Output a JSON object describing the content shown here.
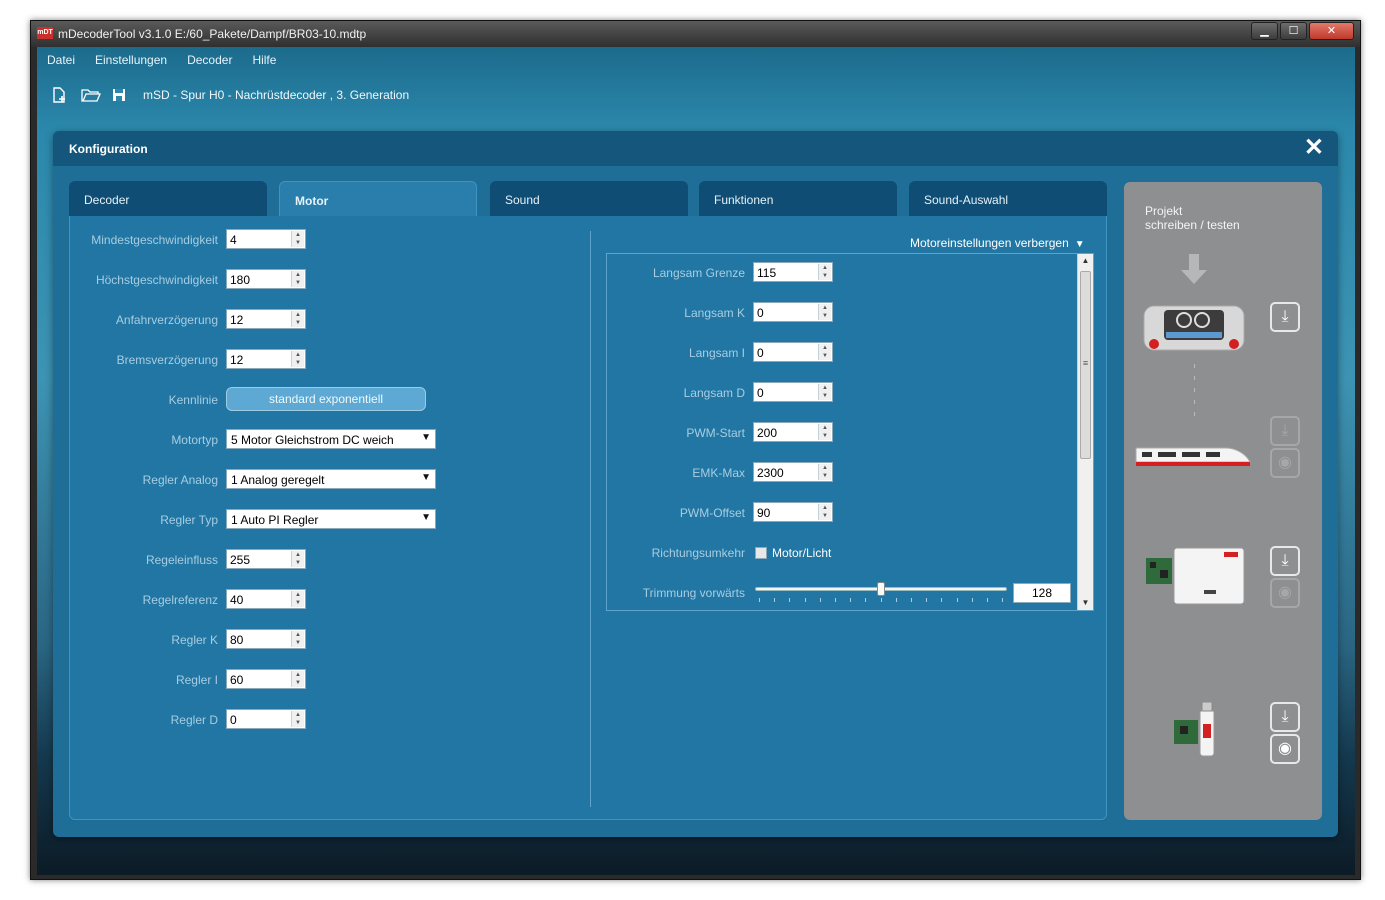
{
  "window": {
    "title": "mDecoderTool v3.1.0  E:/60_Pakete/Dampf/BR03-10.mdtp",
    "app_icon_text": "mDT",
    "buttons": {
      "minimize": "▁",
      "maximize": "☐",
      "close": "✕"
    }
  },
  "menu": [
    "Datei",
    "Einstellungen",
    "Decoder",
    "Hilfe"
  ],
  "toolbar": {
    "icons": [
      "new-file-icon",
      "open-folder-icon",
      "save-icon"
    ],
    "decoder_text": "mSD - Spur H0 - Nachrüstdecoder , 3. Generation"
  },
  "panel": {
    "title": "Konfiguration",
    "close_glyph": "✕"
  },
  "tabs": [
    "Decoder",
    "Motor",
    "Sound",
    "Funktionen",
    "Sound-Auswahl"
  ],
  "active_tab": "Motor",
  "motor": {
    "fields": [
      {
        "label": "Mindestgeschwindigkeit",
        "value": "4"
      },
      {
        "label": "Höchstgeschwindigkeit",
        "value": "180"
      },
      {
        "label": "Anfahrverzögerung",
        "value": "12"
      },
      {
        "label": "Bremsverzögerung",
        "value": "12"
      }
    ],
    "kennlinie": {
      "label": "Kennlinie",
      "button": "standard exponentiell"
    },
    "dropdowns": [
      {
        "label": "Motortyp",
        "value": "5 Motor Gleichstrom DC weich"
      },
      {
        "label": "Regler Analog",
        "value": "1 Analog geregelt"
      },
      {
        "label": "Regler Typ",
        "value": "1 Auto PI Regler"
      }
    ],
    "fields2": [
      {
        "label": "Regeleinfluss",
        "value": "255"
      },
      {
        "label": "Regelreferenz",
        "value": "40"
      },
      {
        "label": "Regler K",
        "value": "80"
      },
      {
        "label": "Regler I",
        "value": "60"
      },
      {
        "label": "Regler D",
        "value": "0"
      }
    ]
  },
  "advanced": {
    "toggle_label": "Motoreinstellungen verbergen",
    "fields": [
      {
        "label": "Langsam Grenze",
        "value": "115"
      },
      {
        "label": "Langsam K",
        "value": "0"
      },
      {
        "label": "Langsam I",
        "value": "0"
      },
      {
        "label": "Langsam D",
        "value": "0"
      },
      {
        "label": "PWM-Start",
        "value": "200"
      },
      {
        "label": "EMK-Max",
        "value": "2300"
      },
      {
        "label": "PWM-Offset",
        "value": "90"
      }
    ],
    "richtung": {
      "label": "Richtungsumkehr",
      "checkbox_label": "Motor/Licht",
      "checked": false
    },
    "trimmung": {
      "label": "Trimmung vorwärts",
      "value": "128",
      "min": 0,
      "max": 255
    }
  },
  "side": {
    "title_line1": "Projekt",
    "title_line2": "schreiben / testen",
    "devices": [
      "central-station-device",
      "ice-train-device",
      "programmer-box-device",
      "usb-stick-device"
    ]
  },
  "colors": {
    "panel": "#1f6e98",
    "header": "#15577c",
    "tab": "#0f4d74",
    "active_tab": "#2a7eab",
    "side": "#8d8f91"
  }
}
